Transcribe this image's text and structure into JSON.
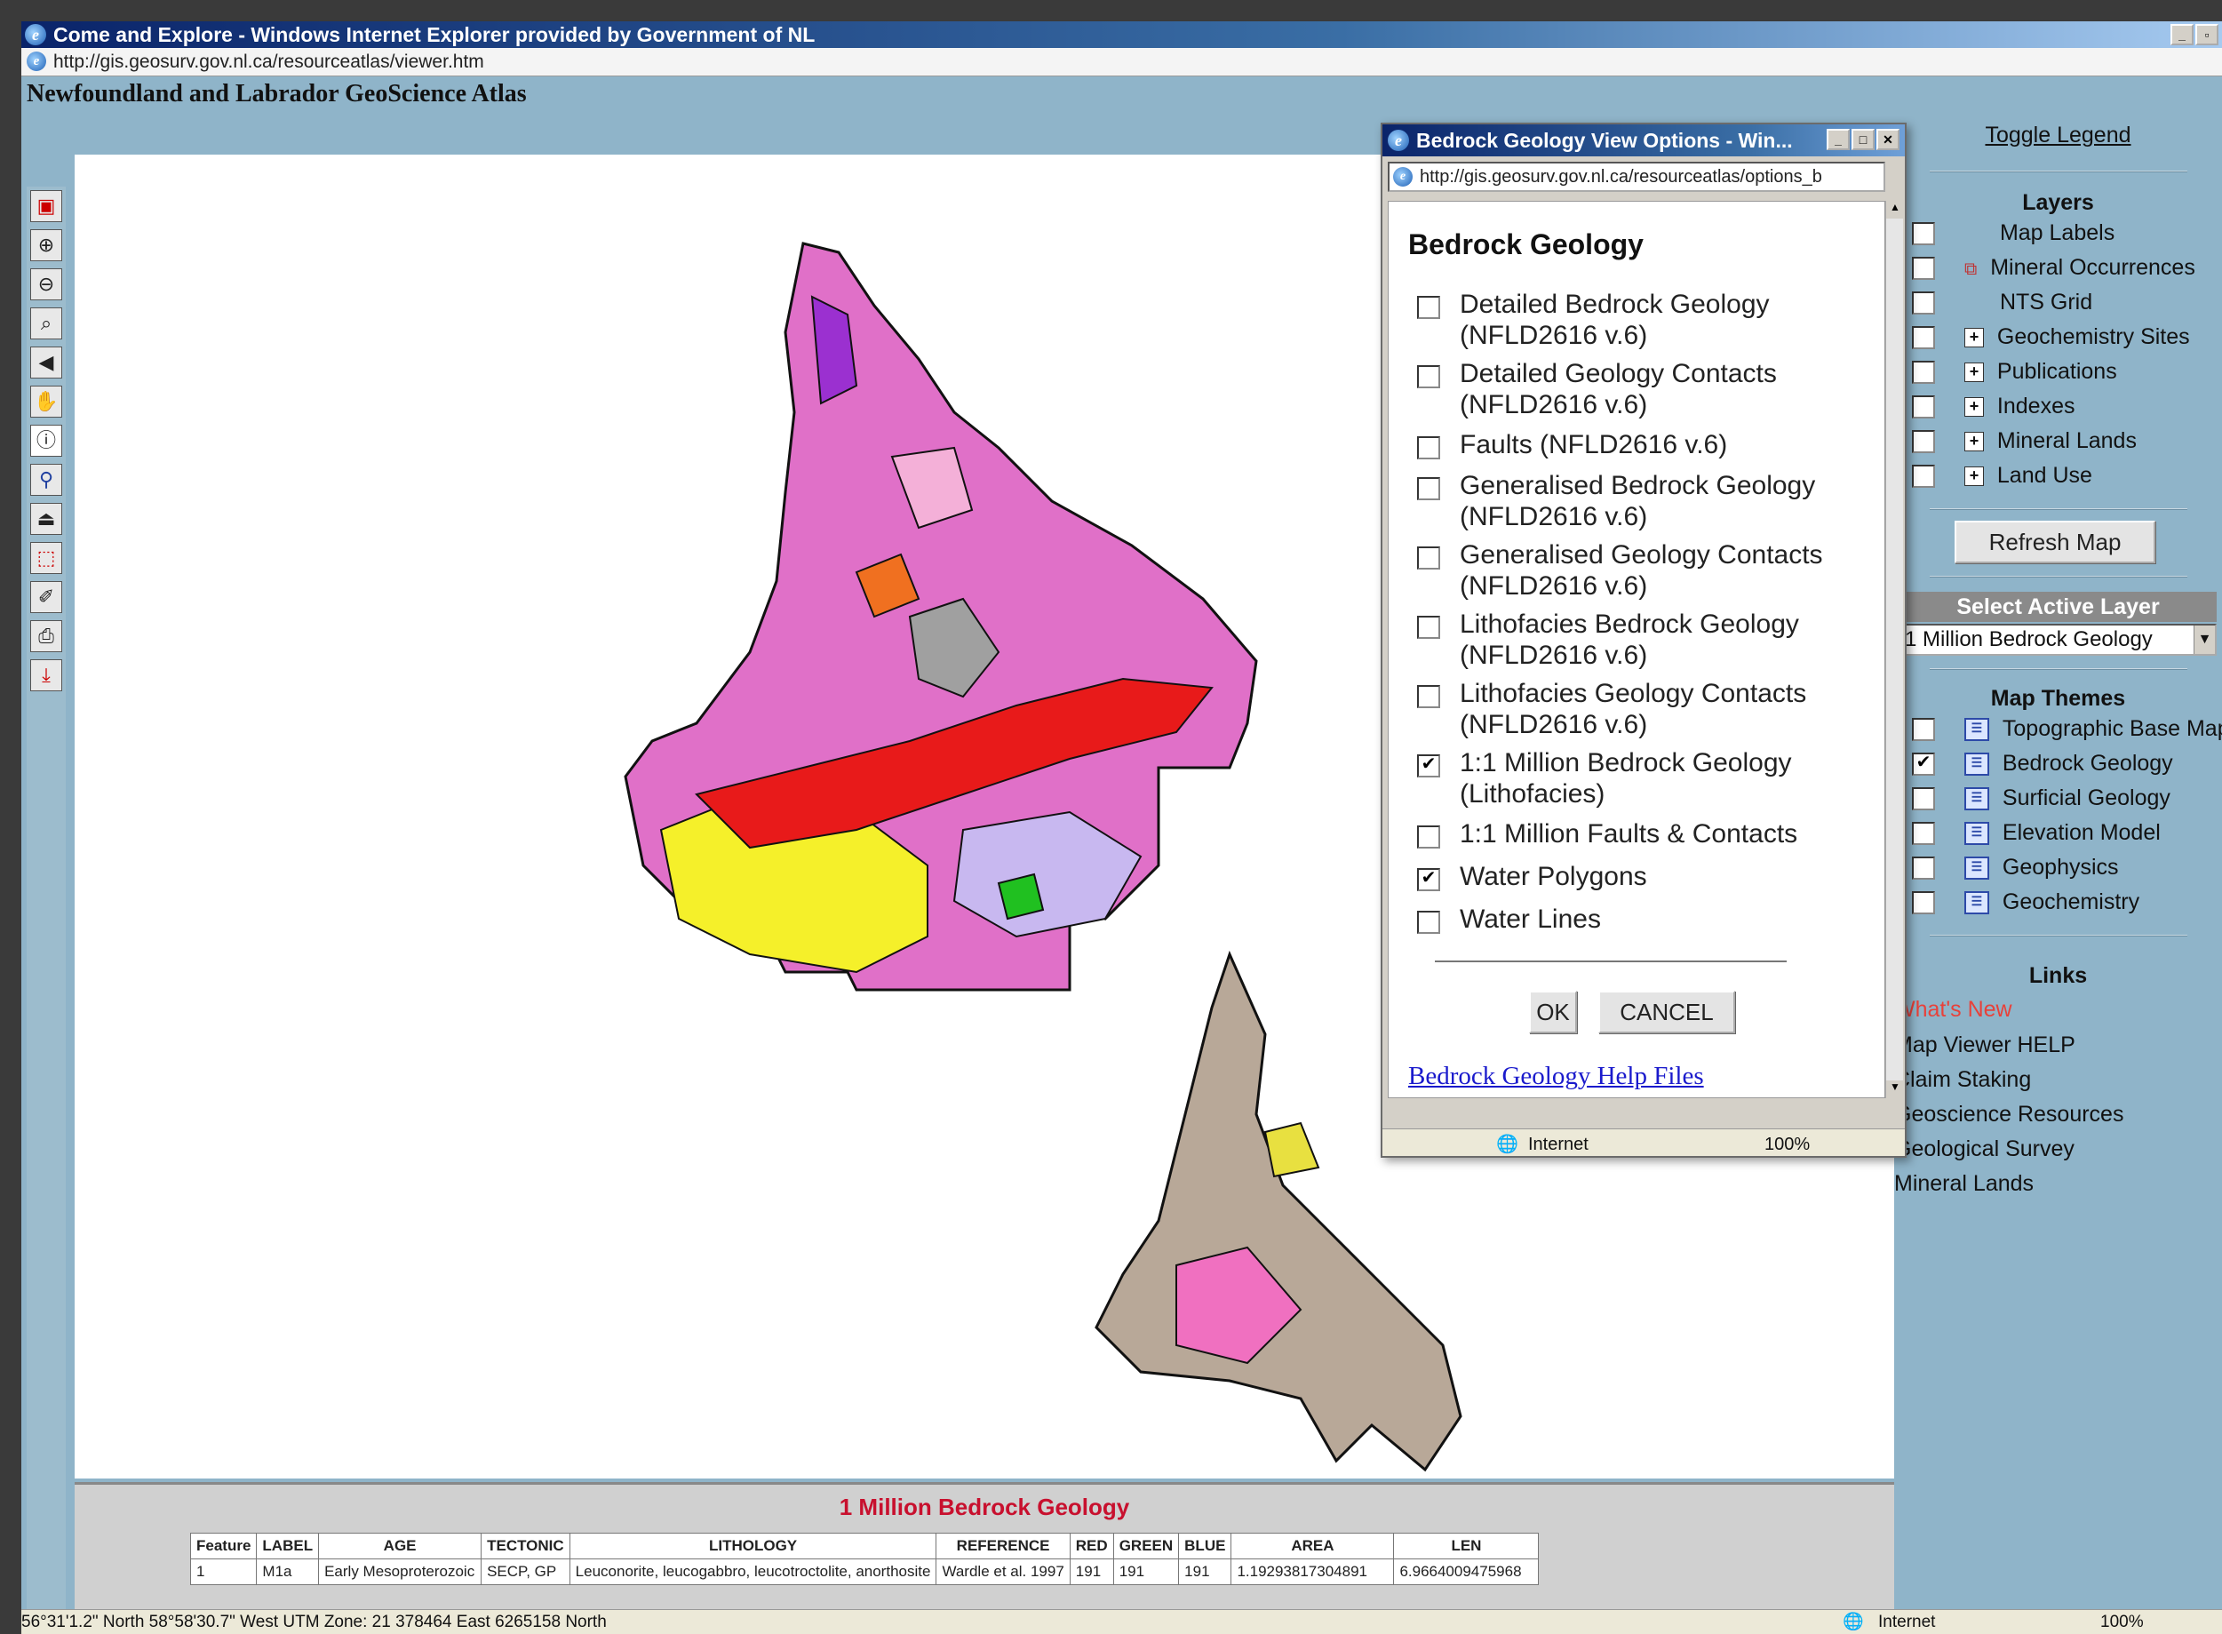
{
  "window": {
    "title": "Come and Explore - Windows Internet Explorer provided by Government of NL",
    "url": "http://gis.geosurv.gov.nl.ca/resourceatlas/viewer.htm"
  },
  "page": {
    "title": "Newfoundland and Labrador GeoScience Atlas"
  },
  "results": {
    "title": "1 Million Bedrock Geology",
    "columns": [
      "Feature",
      "LABEL",
      "AGE",
      "TECTONIC",
      "LITHOLOGY",
      "REFERENCE",
      "RED",
      "GREEN",
      "BLUE",
      "AREA",
      "LEN"
    ],
    "row": [
      "1",
      "M1a",
      "Early Mesoproterozoic",
      "SECP, GP",
      "Leuconorite, leucogabbro, leucotroctolite, anorthosite",
      "Wardle et al. 1997",
      "191",
      "191",
      "191",
      "1.19293817304891",
      "6.9664009475968"
    ]
  },
  "panel": {
    "toggle_legend": "Toggle Legend",
    "layers_heading": "Layers",
    "layers": [
      {
        "label": "Map Labels",
        "checked": false,
        "expand": false
      },
      {
        "label": "Mineral Occurrences",
        "checked": false,
        "expand": false
      },
      {
        "label": "NTS Grid",
        "checked": false,
        "expand": false
      },
      {
        "label": "Geochemistry Sites",
        "checked": false,
        "expand": true
      },
      {
        "label": "Publications",
        "checked": false,
        "expand": true
      },
      {
        "label": "Indexes",
        "checked": false,
        "expand": true
      },
      {
        "label": "Mineral Lands",
        "checked": false,
        "expand": true
      },
      {
        "label": "Land Use",
        "checked": false,
        "expand": true
      }
    ],
    "refresh_button": "Refresh Map",
    "active_layer_heading": "Select Active Layer",
    "active_layer_value": "1 Million Bedrock Geology",
    "themes_heading": "Map Themes",
    "themes": [
      {
        "label": "Topographic Base Map",
        "checked": false
      },
      {
        "label": "Bedrock Geology",
        "checked": true
      },
      {
        "label": "Surficial Geology",
        "checked": false
      },
      {
        "label": "Elevation Model",
        "checked": false
      },
      {
        "label": "Geophysics",
        "checked": false
      },
      {
        "label": "Geochemistry",
        "checked": false
      }
    ],
    "links_heading": "Links",
    "links": [
      "What's New",
      "Map Viewer HELP",
      "Claim Staking",
      "Geoscience Resources",
      "Geological Survey",
      "Mineral Lands"
    ],
    "whats_new_color": "#e8413a"
  },
  "status": {
    "coords": "56°31'1.2\" North 58°58'30.7\" West   UTM Zone: 21 378464 East 6265158 North",
    "zone": "Internet",
    "zoom": "100%"
  },
  "dialog": {
    "title": "Bedrock Geology View Options - Win...",
    "url": "http://gis.geosurv.gov.nl.ca/resourceatlas/options_b",
    "heading": "Bedrock Geology",
    "options": [
      {
        "line1": "Detailed Bedrock Geology",
        "line2": "(NFLD2616 v.6)",
        "checked": false
      },
      {
        "line1": "Detailed Geology Contacts",
        "line2": "(NFLD2616 v.6)",
        "checked": false
      },
      {
        "line1": "Faults (NFLD2616 v.6)",
        "line2": "",
        "checked": false
      },
      {
        "line1": "Generalised Bedrock Geology",
        "line2": "(NFLD2616 v.6)",
        "checked": false
      },
      {
        "line1": "Generalised Geology Contacts",
        "line2": "(NFLD2616 v.6)",
        "checked": false
      },
      {
        "line1": "Lithofacies Bedrock Geology",
        "line2": "(NFLD2616 v.6)",
        "checked": false
      },
      {
        "line1": "Lithofacies Geology Contacts",
        "line2": "(NFLD2616 v.6)",
        "checked": false
      },
      {
        "line1": "1:1 Million Bedrock Geology",
        "line2": "(Lithofacies)",
        "checked": true
      },
      {
        "line1": "1:1 Million Faults & Contacts",
        "line2": "",
        "checked": false
      },
      {
        "line1": "Water Polygons",
        "line2": "",
        "checked": true
      },
      {
        "line1": "Water Lines",
        "line2": "",
        "checked": false
      }
    ],
    "ok": "OK",
    "cancel": "CANCEL",
    "help_link": "Bedrock Geology Help Files",
    "status_zone": "Internet",
    "status_zoom": "100%"
  }
}
